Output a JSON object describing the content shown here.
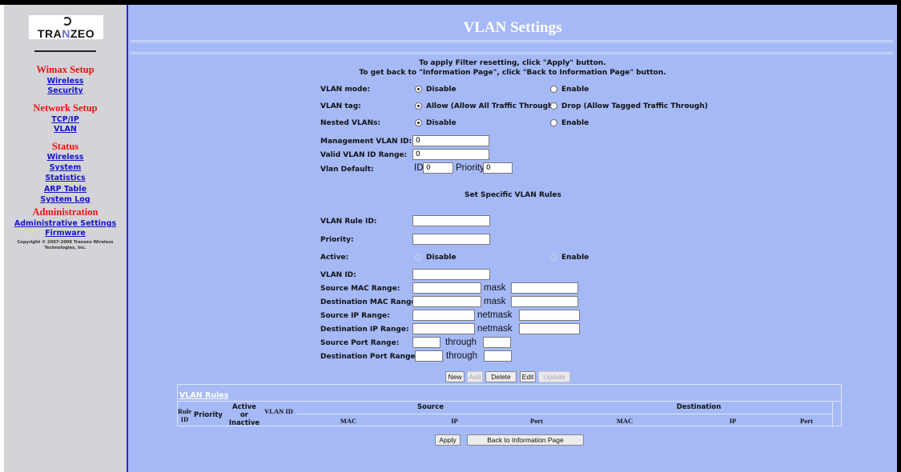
{
  "sidebar": {
    "logo_text": "TRANZEO",
    "sections": [
      {
        "title": "Wimax Setup",
        "links": [
          "Wireless",
          "Security"
        ]
      },
      {
        "title": "Network Setup",
        "links": [
          "TCP/IP",
          "VLAN"
        ]
      },
      {
        "title": "Status",
        "links": [
          "Wireless",
          "System",
          "Statistics",
          "ARP Table",
          "System Log"
        ]
      },
      {
        "title": "Administration",
        "links": [
          "Administrative Settings",
          "Firmware"
        ]
      }
    ],
    "copyright": "Copyright © 2007-2008 Tranzeo Wireless Technologies, Inc."
  },
  "main": {
    "title": "VLAN Settings",
    "info_line1": "To apply Filter resetting, click \"Apply\" button.",
    "info_line2": "To get back to \"Information Page\", click \"Back to Information Page\" button.",
    "vlan_mode": {
      "label": "VLAN mode:",
      "options": [
        "Disable",
        "Enable"
      ],
      "selected": "Disable"
    },
    "vlan_tag": {
      "label": "VLAN tag:",
      "options": [
        "Allow (Allow All Traffic Through)",
        "Drop (Allow Tagged Traffic Through)"
      ],
      "selected": "Allow (Allow All Traffic Through)"
    },
    "nested_vlans": {
      "label": "Nested VLANs:",
      "options": [
        "Disable",
        "Enable"
      ],
      "selected": "Disable"
    },
    "management_vlan_id": {
      "label": "Management VLAN ID:",
      "value": "0"
    },
    "valid_vlan_id_range": {
      "label": "Valid VLAN ID Range:",
      "value": "0"
    },
    "vlan_default": {
      "label": "Vlan Default:",
      "id_label": "ID",
      "id_value": "0",
      "priority_label": "Priority",
      "priority_value": "0"
    },
    "specific_rules_heading": "Set Specific VLAN Rules",
    "rule_form": {
      "vlan_rule_id_label": "VLAN Rule ID:",
      "priority_label": "Priority:",
      "active_label": "Active:",
      "active_options": [
        "Disable",
        "Enable"
      ],
      "vlan_id_label": "VLAN ID:",
      "source_mac_label": "Source MAC Range:",
      "dest_mac_label": "Destination MAC Range:",
      "source_ip_label": "Source IP Range:",
      "dest_ip_label": "Destination IP Range:",
      "source_port_label": "Source Port Range:",
      "dest_port_label": "Destination Port Range:",
      "mask_label": "mask",
      "netmask_label": "netmask",
      "through_label": "through"
    },
    "buttons": {
      "new": "New",
      "add": "Add",
      "delete": "Delete",
      "edit": "Edit",
      "update": "Update"
    },
    "rules_table": {
      "title": "VLAN Rules",
      "headers": {
        "rule_id": "Rule ID",
        "priority": "Priority",
        "active": "Active or Inactive",
        "vlan_id": "VLAN ID",
        "source": "Source",
        "destination": "Destination"
      },
      "sub_headers": {
        "mac": "MAC",
        "ip": "IP",
        "port": "Port"
      }
    },
    "apply_button": "Apply",
    "back_button": "Back to Information Page"
  },
  "colors": {
    "main_bg": "#a5b9f7",
    "sidebar_bg": "#d4d4d8",
    "section_title": "#ee1111",
    "link": "#1515c8"
  }
}
